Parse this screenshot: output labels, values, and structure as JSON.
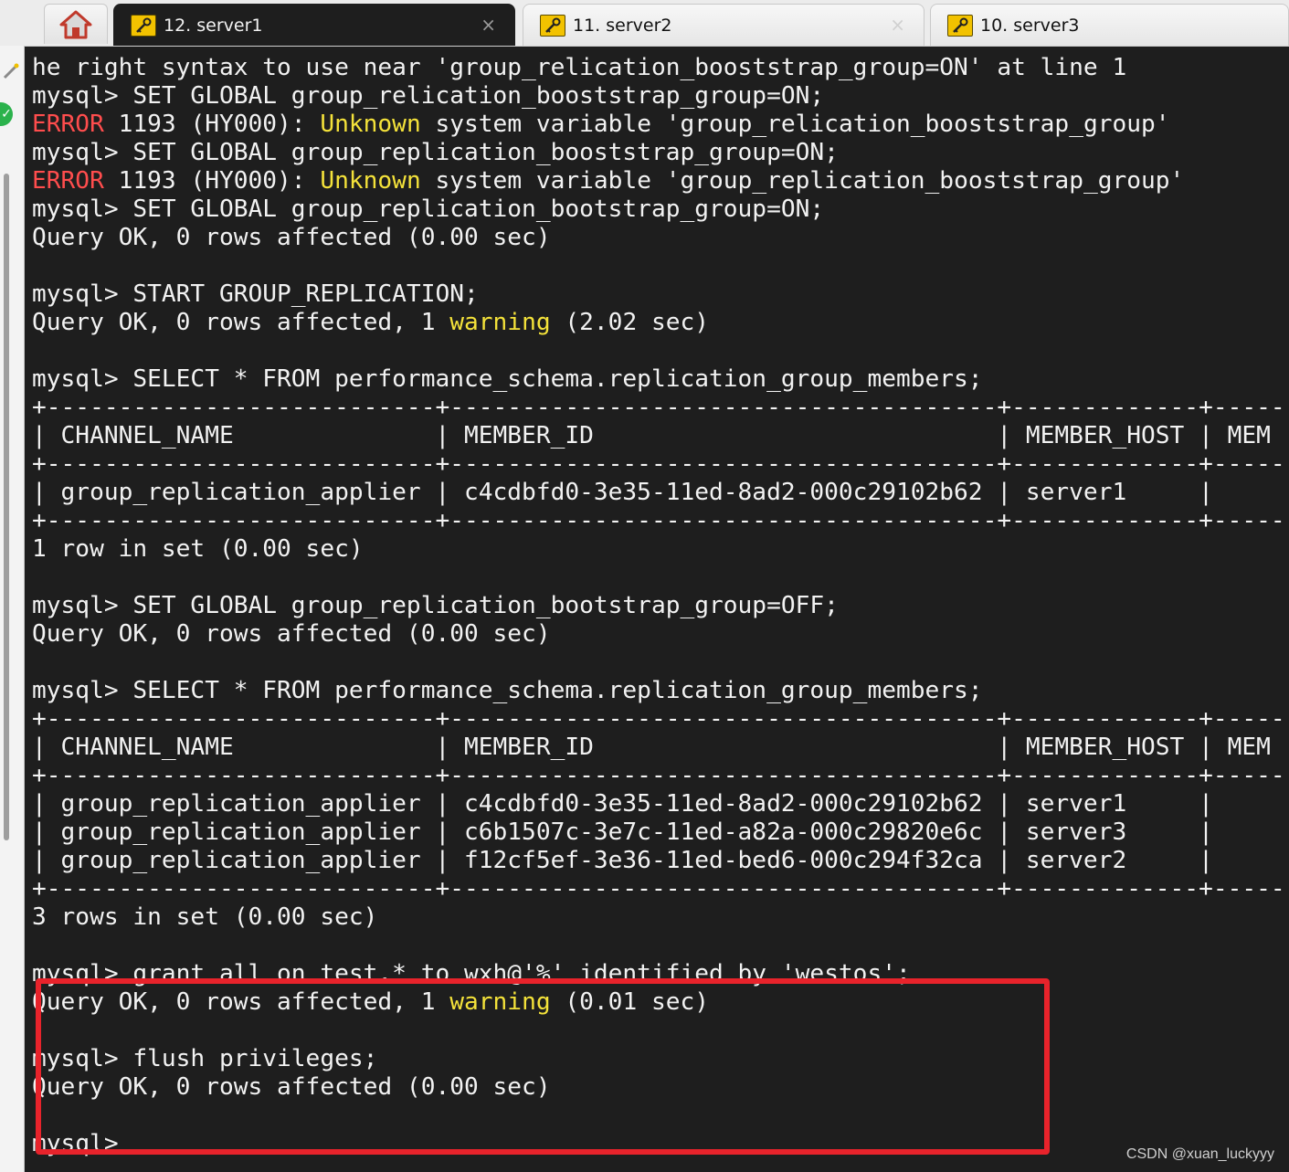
{
  "tabs": [
    {
      "label": "12. server1",
      "active": true,
      "icon": "key-icon",
      "close": "×"
    },
    {
      "label": "11. server2",
      "active": false,
      "icon": "key-icon",
      "close": "×"
    },
    {
      "label": "10. server3",
      "active": false,
      "icon": "key-icon",
      "close": ""
    }
  ],
  "home_icon": "home-icon",
  "terminal": {
    "lines": [
      [
        {
          "t": "he right syntax to use near 'group_relication_booststrap_group=ON' at line 1"
        }
      ],
      [
        {
          "t": "mysql> SET GLOBAL group_relication_booststrap_group=ON;"
        }
      ],
      [
        {
          "t": "ERROR",
          "c": "red"
        },
        {
          "t": " 1193 (HY000): "
        },
        {
          "t": "Unknown",
          "c": "yellow"
        },
        {
          "t": " system variable 'group_relication_booststrap_group'"
        }
      ],
      [
        {
          "t": "mysql> SET GLOBAL group_replication_booststrap_group=ON;"
        }
      ],
      [
        {
          "t": "ERROR",
          "c": "red"
        },
        {
          "t": " 1193 (HY000): "
        },
        {
          "t": "Unknown",
          "c": "yellow"
        },
        {
          "t": " system variable 'group_replication_booststrap_group'"
        }
      ],
      [
        {
          "t": "mysql> SET GLOBAL group_replication_bootstrap_group=ON;"
        }
      ],
      [
        {
          "t": "Query OK, 0 rows affected (0.00 sec)"
        }
      ],
      [
        {
          "t": ""
        }
      ],
      [
        {
          "t": "mysql> START GROUP_REPLICATION;"
        }
      ],
      [
        {
          "t": "Query OK, 0 rows affected, 1 "
        },
        {
          "t": "warning",
          "c": "yellow"
        },
        {
          "t": " (2.02 sec)"
        }
      ],
      [
        {
          "t": ""
        }
      ],
      [
        {
          "t": "mysql> SELECT * FROM performance_schema.replication_group_members;"
        }
      ],
      [
        {
          "t": "+---------------------------+--------------------------------------+-------------+-----"
        }
      ],
      [
        {
          "t": "| CHANNEL_NAME              | MEMBER_ID                            | MEMBER_HOST | MEM"
        }
      ],
      [
        {
          "t": "+---------------------------+--------------------------------------+-------------+-----"
        }
      ],
      [
        {
          "t": "| group_replication_applier | c4cdbfd0-3e35-11ed-8ad2-000c29102b62 | server1     |"
        }
      ],
      [
        {
          "t": "+---------------------------+--------------------------------------+-------------+-----"
        }
      ],
      [
        {
          "t": "1 row in set (0.00 sec)"
        }
      ],
      [
        {
          "t": ""
        }
      ],
      [
        {
          "t": "mysql> SET GLOBAL group_replication_bootstrap_group=OFF;"
        }
      ],
      [
        {
          "t": "Query OK, 0 rows affected (0.00 sec)"
        }
      ],
      [
        {
          "t": ""
        }
      ],
      [
        {
          "t": "mysql> SELECT * FROM performance_schema.replication_group_members;"
        }
      ],
      [
        {
          "t": "+---------------------------+--------------------------------------+-------------+-----"
        }
      ],
      [
        {
          "t": "| CHANNEL_NAME              | MEMBER_ID                            | MEMBER_HOST | MEM"
        }
      ],
      [
        {
          "t": "+---------------------------+--------------------------------------+-------------+-----"
        }
      ],
      [
        {
          "t": "| group_replication_applier | c4cdbfd0-3e35-11ed-8ad2-000c29102b62 | server1     |"
        }
      ],
      [
        {
          "t": "| group_replication_applier | c6b1507c-3e7c-11ed-a82a-000c29820e6c | server3     |"
        }
      ],
      [
        {
          "t": "| group_replication_applier | f12cf5ef-3e36-11ed-bed6-000c294f32ca | server2     |"
        }
      ],
      [
        {
          "t": "+---------------------------+--------------------------------------+-------------+-----"
        }
      ],
      [
        {
          "t": "3 rows in set (0.00 sec)"
        }
      ],
      [
        {
          "t": ""
        }
      ],
      [
        {
          "t": "mysql> grant all on test.* to wxh@'%' identified by 'westos';"
        }
      ],
      [
        {
          "t": "Query OK, 0 rows affected, 1 "
        },
        {
          "t": "warning",
          "c": "yellow"
        },
        {
          "t": " (0.01 sec)"
        }
      ],
      [
        {
          "t": ""
        }
      ],
      [
        {
          "t": "mysql> flush privileges;"
        }
      ],
      [
        {
          "t": "Query OK, 0 rows affected (0.00 sec)"
        }
      ],
      [
        {
          "t": ""
        }
      ],
      [
        {
          "t": "mysql> "
        }
      ]
    ]
  },
  "colors": {
    "terminal_bg": "#1e1e1e",
    "text": "#f2f2f2",
    "error": "#ff4d4d",
    "highlight_word": "#f4e23a",
    "annotation_box": "#e8232b"
  },
  "watermark": "CSDN @xuan_luckyyy"
}
